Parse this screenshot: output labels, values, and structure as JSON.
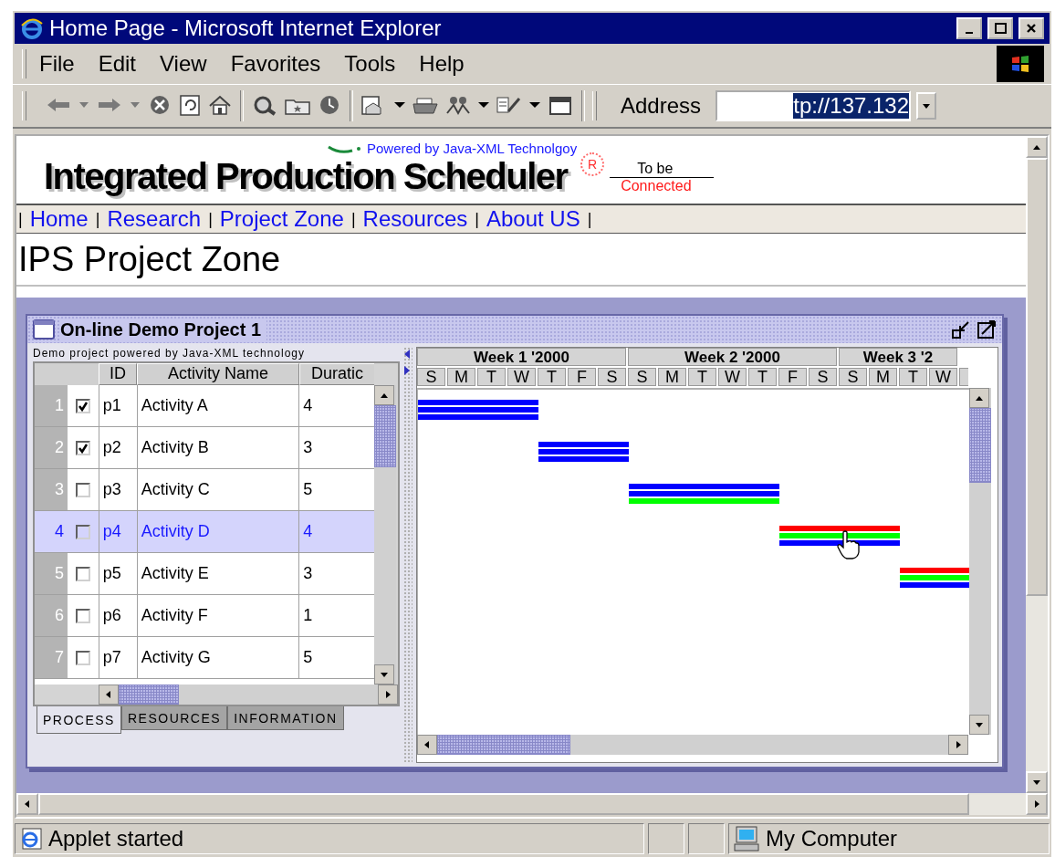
{
  "window": {
    "title": "Home Page - Microsoft Internet Explorer"
  },
  "menu": [
    {
      "label": "File"
    },
    {
      "label": "Edit"
    },
    {
      "label": "View"
    },
    {
      "label": "Favorites"
    },
    {
      "label": "Tools"
    },
    {
      "label": "Help"
    }
  ],
  "address": {
    "label": "Address",
    "value": "tp://137.132"
  },
  "page": {
    "powered_by": "Powered by Java-XML Technolgoy",
    "logo": "Integrated Production Scheduler",
    "registered_mark": "R",
    "connection": {
      "line_1": "To be",
      "line_2": "Connected"
    },
    "nav_separator": "|",
    "nav": [
      {
        "label": "Home"
      },
      {
        "label": "Research"
      },
      {
        "label": "Project Zone"
      },
      {
        "label": "Resources"
      },
      {
        "label": "About US"
      }
    ],
    "heading": "IPS Project Zone"
  },
  "applet": {
    "title": "On-line Demo Project 1",
    "subtitle": "Demo project powered by Java-XML technology",
    "columns": [
      "ID",
      "Activity Name",
      "Duratic"
    ],
    "rows": [
      {
        "number": "1",
        "checked": true,
        "id": "p1",
        "name": "Activity A",
        "duration": "4",
        "selected": false
      },
      {
        "number": "2",
        "checked": true,
        "id": "p2",
        "name": "Activity B",
        "duration": "3",
        "selected": false
      },
      {
        "number": "3",
        "checked": false,
        "id": "p3",
        "name": "Activity C",
        "duration": "5",
        "selected": false
      },
      {
        "number": "4",
        "checked": false,
        "id": "p4",
        "name": "Activity D",
        "duration": "4",
        "selected": true
      },
      {
        "number": "5",
        "checked": false,
        "id": "p5",
        "name": "Activity E",
        "duration": "3",
        "selected": false
      },
      {
        "number": "6",
        "checked": false,
        "id": "p6",
        "name": "Activity F",
        "duration": "1",
        "selected": false
      },
      {
        "number": "7",
        "checked": false,
        "id": "p7",
        "name": "Activity G",
        "duration": "5",
        "selected": false
      }
    ],
    "tabs": [
      {
        "label": "PROCESS",
        "selected": true
      },
      {
        "label": "RESOURCES",
        "selected": false
      },
      {
        "label": "INFORMATION",
        "selected": false
      }
    ],
    "weeks": [
      {
        "label": "Week 1 '2000",
        "days": [
          "S",
          "M",
          "T",
          "W",
          "T",
          "F",
          "S"
        ]
      },
      {
        "label": "Week 2 '2000",
        "days": [
          "S",
          "M",
          "T",
          "W",
          "T",
          "F",
          "S"
        ]
      },
      {
        "label": "Week 3 '2",
        "days": [
          "S",
          "M",
          "T",
          "W"
        ]
      }
    ],
    "bars": [
      {
        "stripes": [
          {
            "color": "#0000ff"
          },
          {
            "color": "#0000ff"
          },
          {
            "color": "#0000ff"
          }
        ]
      },
      {
        "stripes": [
          {
            "color": "#0000ff"
          },
          {
            "color": "#0000ff"
          },
          {
            "color": "#0000ff"
          }
        ]
      },
      {
        "stripes": [
          {
            "color": "#0000ff"
          },
          {
            "color": "#0000ff"
          },
          {
            "color": "#00ff00"
          }
        ]
      },
      {
        "stripes": [
          {
            "color": "#ff0000"
          },
          {
            "color": "#00ff00"
          },
          {
            "color": "#0000ff"
          }
        ]
      },
      {
        "stripes": [
          {
            "color": "#ff0000"
          },
          {
            "color": "#00ff00"
          },
          {
            "color": "#0000ff"
          }
        ]
      }
    ]
  },
  "status_bar": {
    "text": "Applet started",
    "zone": "My Computer"
  }
}
